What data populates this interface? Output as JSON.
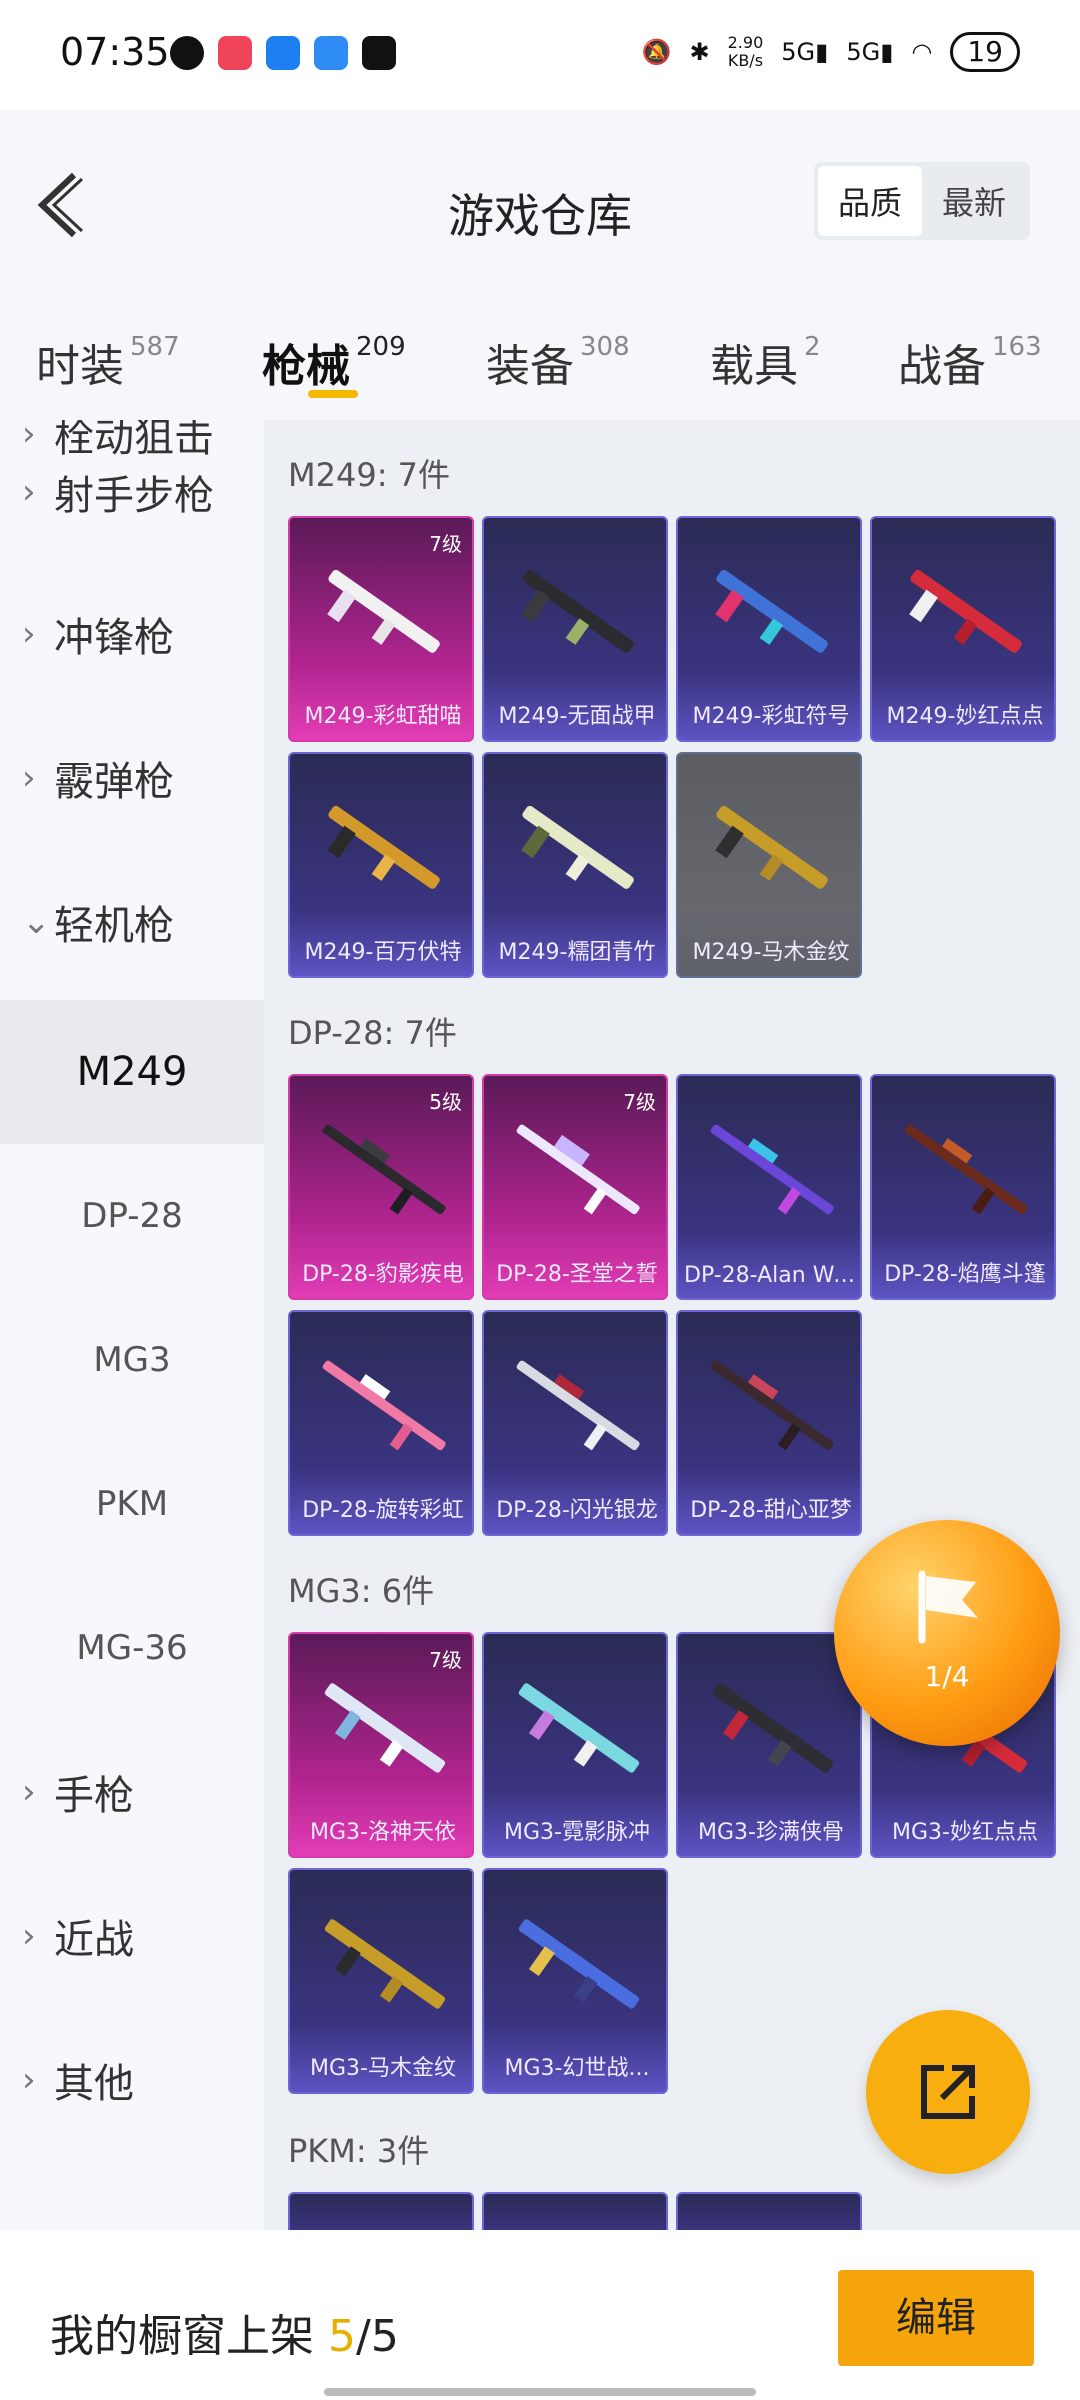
{
  "status_bar": {
    "time": "07:35",
    "speed": "2.90",
    "speed_unit": "KB/s",
    "battery": "19"
  },
  "header": {
    "title": "游戏仓库",
    "sort_options": [
      "品质",
      "最新"
    ]
  },
  "tabs": [
    {
      "label": "时装",
      "count": "587"
    },
    {
      "label": "枪械",
      "count": "209"
    },
    {
      "label": "装备",
      "count": "308"
    },
    {
      "label": "载具",
      "count": "2"
    },
    {
      "label": "战备",
      "count": "163"
    }
  ],
  "sidebar": {
    "partial_item": "栓动狙击",
    "items": [
      "射手步枪",
      "冲锋枪",
      "霰弹枪",
      "轻机枪"
    ],
    "subitems": [
      "M249",
      "DP-28",
      "MG3",
      "PKM",
      "MG-36"
    ],
    "more_items": [
      "手枪",
      "近战",
      "其他"
    ]
  },
  "groups": [
    {
      "title": "M249: 7件",
      "items": [
        {
          "name": "M249-彩虹甜喵",
          "level": "7级",
          "rarity": "pink"
        },
        {
          "name": "M249-无面战甲",
          "level": "",
          "rarity": "purple"
        },
        {
          "name": "M249-彩虹符号",
          "level": "",
          "rarity": "purple"
        },
        {
          "name": "M249-妙红点点",
          "level": "",
          "rarity": "purple"
        },
        {
          "name": "M249-百万伏特",
          "level": "",
          "rarity": "purple"
        },
        {
          "name": "M249-糯团青竹",
          "level": "",
          "rarity": "purple"
        },
        {
          "name": "M249-马木金纹",
          "level": "",
          "rarity": "grey"
        }
      ]
    },
    {
      "title": "DP-28: 7件",
      "items": [
        {
          "name": "DP-28-豹影疾电",
          "level": "5级",
          "rarity": "pink"
        },
        {
          "name": "DP-28-圣堂之誓",
          "level": "7级",
          "rarity": "pink"
        },
        {
          "name": "DP-28-Alan Wo...",
          "level": "",
          "rarity": "purple"
        },
        {
          "name": "DP-28-焰鹰斗篷",
          "level": "",
          "rarity": "purple"
        },
        {
          "name": "DP-28-旋转彩虹",
          "level": "",
          "rarity": "purple"
        },
        {
          "name": "DP-28-闪光银龙",
          "level": "",
          "rarity": "purple"
        },
        {
          "name": "DP-28-甜心亚梦",
          "level": "",
          "rarity": "purple"
        }
      ]
    },
    {
      "title": "MG3: 6件",
      "items": [
        {
          "name": "MG3-洛神天依",
          "level": "7级",
          "rarity": "pink"
        },
        {
          "name": "MG3-霓影脉冲",
          "level": "",
          "rarity": "purple"
        },
        {
          "name": "MG3-珍满侠骨",
          "level": "",
          "rarity": "purple"
        },
        {
          "name": "MG3-妙红点点",
          "level": "",
          "rarity": "purple"
        },
        {
          "name": "MG3-马木金纹",
          "level": "",
          "rarity": "purple"
        },
        {
          "name": "MG3-幻世战...",
          "level": "",
          "rarity": "purple"
        }
      ]
    },
    {
      "title": "PKM: 3件",
      "items": []
    }
  ],
  "float": {
    "count": "1/4"
  },
  "bottom": {
    "prefix": "我的橱窗上架 ",
    "current": "5",
    "total": "/5",
    "edit_label": "编辑"
  },
  "colors": {
    "accent": "#f5a40c",
    "pink_card": "#d23ba8",
    "purple_card": "#6c66d8"
  }
}
